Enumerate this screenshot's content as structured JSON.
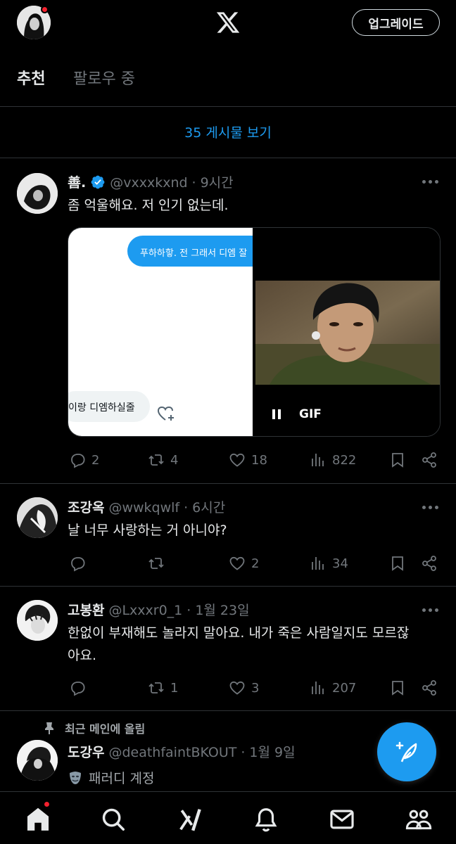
{
  "header": {
    "logo": "X",
    "upgrade_label": "업그레이드"
  },
  "tabs": [
    {
      "label": "추천",
      "active": true
    },
    {
      "label": "팔로우 중",
      "active": false
    }
  ],
  "show_posts_label": "35 게시물 보기",
  "posts": [
    {
      "display_name": "善.",
      "verified": true,
      "handle": "@vxxxkxnd",
      "separator": "·",
      "time": "9시간",
      "text": "좀 억울해요. 저 인기 없는데.",
      "media": {
        "bubble_blue_text": "푸하하핳. 전 그래서 디엠 잘",
        "bubble_gray_text": "이랑 디엠하실줄",
        "gif_label": "GIF"
      },
      "replies": "2",
      "reposts": "4",
      "likes": "18",
      "views": "822"
    },
    {
      "display_name": "조강옥",
      "handle": "@wwkqwlf",
      "separator": "·",
      "time": "6시간",
      "text": "날 너무 사랑하는 거 아니야?",
      "replies": "",
      "reposts": "",
      "likes": "2",
      "views": "34"
    },
    {
      "display_name": "고봉환",
      "handle": "@Lxxxr0_1",
      "separator": "·",
      "time": "1월 23일",
      "text_line1": "한없이 부재해도 놀라지 말아요. 내가 죽은 사람일지도 모르잖",
      "text_line2": "아요.",
      "replies": "",
      "reposts": "1",
      "likes": "3",
      "views": "207"
    },
    {
      "pinned_label": "최근 메인에 올림",
      "display_name": "도강우",
      "handle": "@deathfaintBKOUT",
      "separator": "·",
      "time": "1월 9일",
      "parody_label": "패러디 계정"
    }
  ],
  "colors": {
    "background": "#000000",
    "accent": "#1d9bf0",
    "text_primary": "#e7e9ea",
    "text_secondary": "#71767b",
    "divider": "#2f3336",
    "notification": "#f4212e"
  },
  "icons": {
    "bottom_nav": [
      "home-icon",
      "search-icon",
      "grok-icon",
      "notifications-icon",
      "messages-icon",
      "communities-icon"
    ]
  }
}
